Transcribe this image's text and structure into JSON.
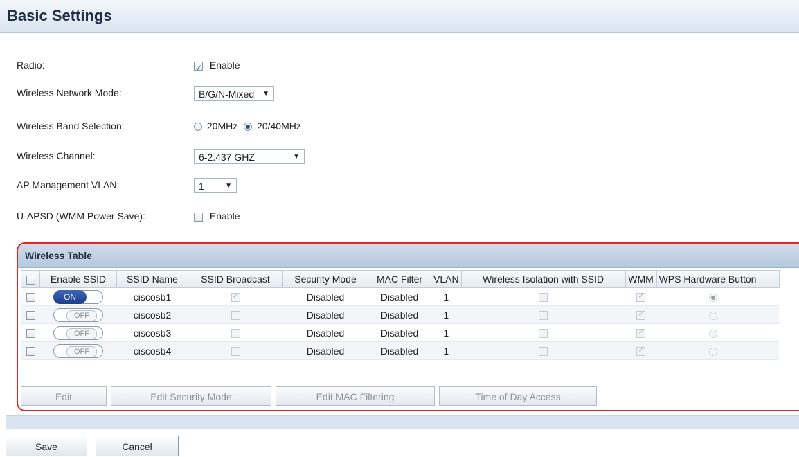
{
  "page": {
    "title": "Basic Settings"
  },
  "form": {
    "radio": {
      "label": "Radio:",
      "option_label": "Enable",
      "checked": true
    },
    "network_mode": {
      "label": "Wireless Network Mode:",
      "value": "B/G/N-Mixed"
    },
    "band": {
      "label": "Wireless Band Selection:",
      "option1": "20MHz",
      "option2": "20/40MHz",
      "selected": "20/40MHz"
    },
    "channel": {
      "label": "Wireless Channel:",
      "value": "6-2.437 GHZ"
    },
    "vlan": {
      "label": "AP Management VLAN:",
      "value": "1"
    },
    "uapsd": {
      "label": "U-APSD (WMM Power Save):",
      "option_label": "Enable",
      "checked": false
    }
  },
  "wireless_table": {
    "title": "Wireless Table",
    "columns": [
      "Enable SSID",
      "SSID Name",
      "SSID Broadcast",
      "Security Mode",
      "MAC Filter",
      "VLAN",
      "Wireless Isolation with SSID",
      "WMM",
      "WPS Hardware Button"
    ],
    "rows": [
      {
        "toggle": "ON",
        "ssid": "ciscosb1",
        "broadcast": true,
        "security": "Disabled",
        "mac_filter": "Disabled",
        "vlan": "1",
        "isolation": false,
        "wmm": true,
        "wps": true
      },
      {
        "toggle": "OFF",
        "ssid": "ciscosb2",
        "broadcast": false,
        "security": "Disabled",
        "mac_filter": "Disabled",
        "vlan": "1",
        "isolation": false,
        "wmm": true,
        "wps": false
      },
      {
        "toggle": "OFF",
        "ssid": "ciscosb3",
        "broadcast": false,
        "security": "Disabled",
        "mac_filter": "Disabled",
        "vlan": "1",
        "isolation": false,
        "wmm": true,
        "wps": false
      },
      {
        "toggle": "OFF",
        "ssid": "ciscosb4",
        "broadcast": false,
        "security": "Disabled",
        "mac_filter": "Disabled",
        "vlan": "1",
        "isolation": false,
        "wmm": true,
        "wps": false
      }
    ],
    "buttons": {
      "edit": "Edit",
      "edit_security": "Edit Security Mode",
      "edit_mac": "Edit MAC Filtering",
      "time_of_day": "Time of Day Access"
    }
  },
  "actions": {
    "save": "Save",
    "cancel": "Cancel"
  },
  "colors": {
    "highlight_border": "#e0262a",
    "toggle_on": "#1c3f88",
    "header_bg": "#d9e4f0"
  }
}
